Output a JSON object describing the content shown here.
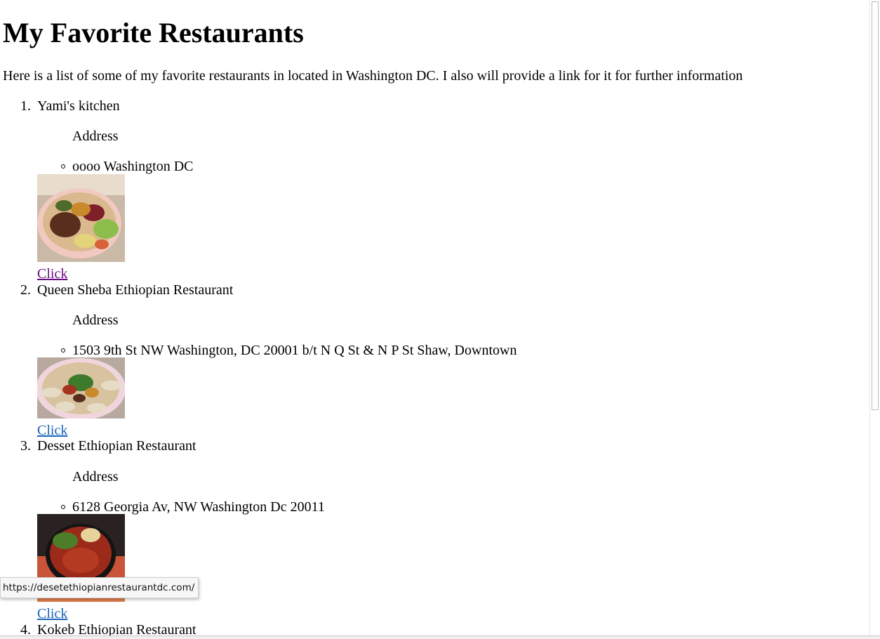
{
  "page": {
    "title": "My Favorite Restaurants",
    "intro": "Here is a list of some of my favorite restaurants in located in Washington DC. I also will provide a link for it for further information"
  },
  "restaurants": [
    {
      "number": "1.",
      "name": "Yami's kitchen",
      "address_label": "Address",
      "address": "oooo Washington DC",
      "link_label": "Click",
      "link_visited": true
    },
    {
      "number": "2.",
      "name": "Queen Sheba Ethiopian Restaurant",
      "address_label": "Address",
      "address": "1503 9th St NW Washington, DC 20001 b/t N Q St & N P St Shaw, Downtown",
      "link_label": "Click",
      "link_visited": false
    },
    {
      "number": "3.",
      "name": "Desset Ethiopian Restaurant",
      "address_label": "Address",
      "address": "6128 Georgia Av, NW Washington Dc 20011",
      "link_label": "Click",
      "link_visited": false
    },
    {
      "number": "4.",
      "name": "Kokeb Ethiopian Restaurant"
    }
  ],
  "status_bar": {
    "hover_url": "https://desetethiopianrestaurantdc.com/"
  },
  "colors": {
    "link": "#1a63b8",
    "visited_link": "#6a0d82"
  }
}
